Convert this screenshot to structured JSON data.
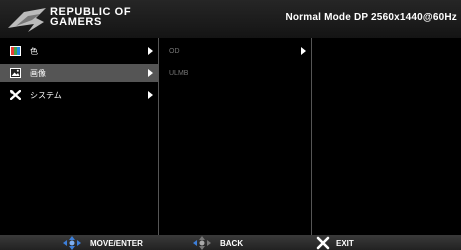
{
  "header": {
    "brand_line1": "REPUBLIC OF",
    "brand_line2": "GAMERS",
    "mode": "Normal Mode DP 2560x1440@60Hz"
  },
  "menu": {
    "items": [
      {
        "label": "色",
        "icon": "color-palette-icon"
      },
      {
        "label": "画像",
        "icon": "image-icon"
      },
      {
        "label": "システム",
        "icon": "tools-icon"
      }
    ],
    "selected_index": 1
  },
  "submenu": {
    "items": [
      {
        "label": "OD",
        "has_arrow": true
      },
      {
        "label": "ULMB",
        "has_arrow": false
      }
    ]
  },
  "footer": {
    "move_enter": "MOVE/ENTER",
    "back": "BACK",
    "exit": "EXIT"
  },
  "colors": {
    "accent_blue": "#3d7fd9",
    "selected_bg": "#555555",
    "disabled_text": "#777777"
  }
}
